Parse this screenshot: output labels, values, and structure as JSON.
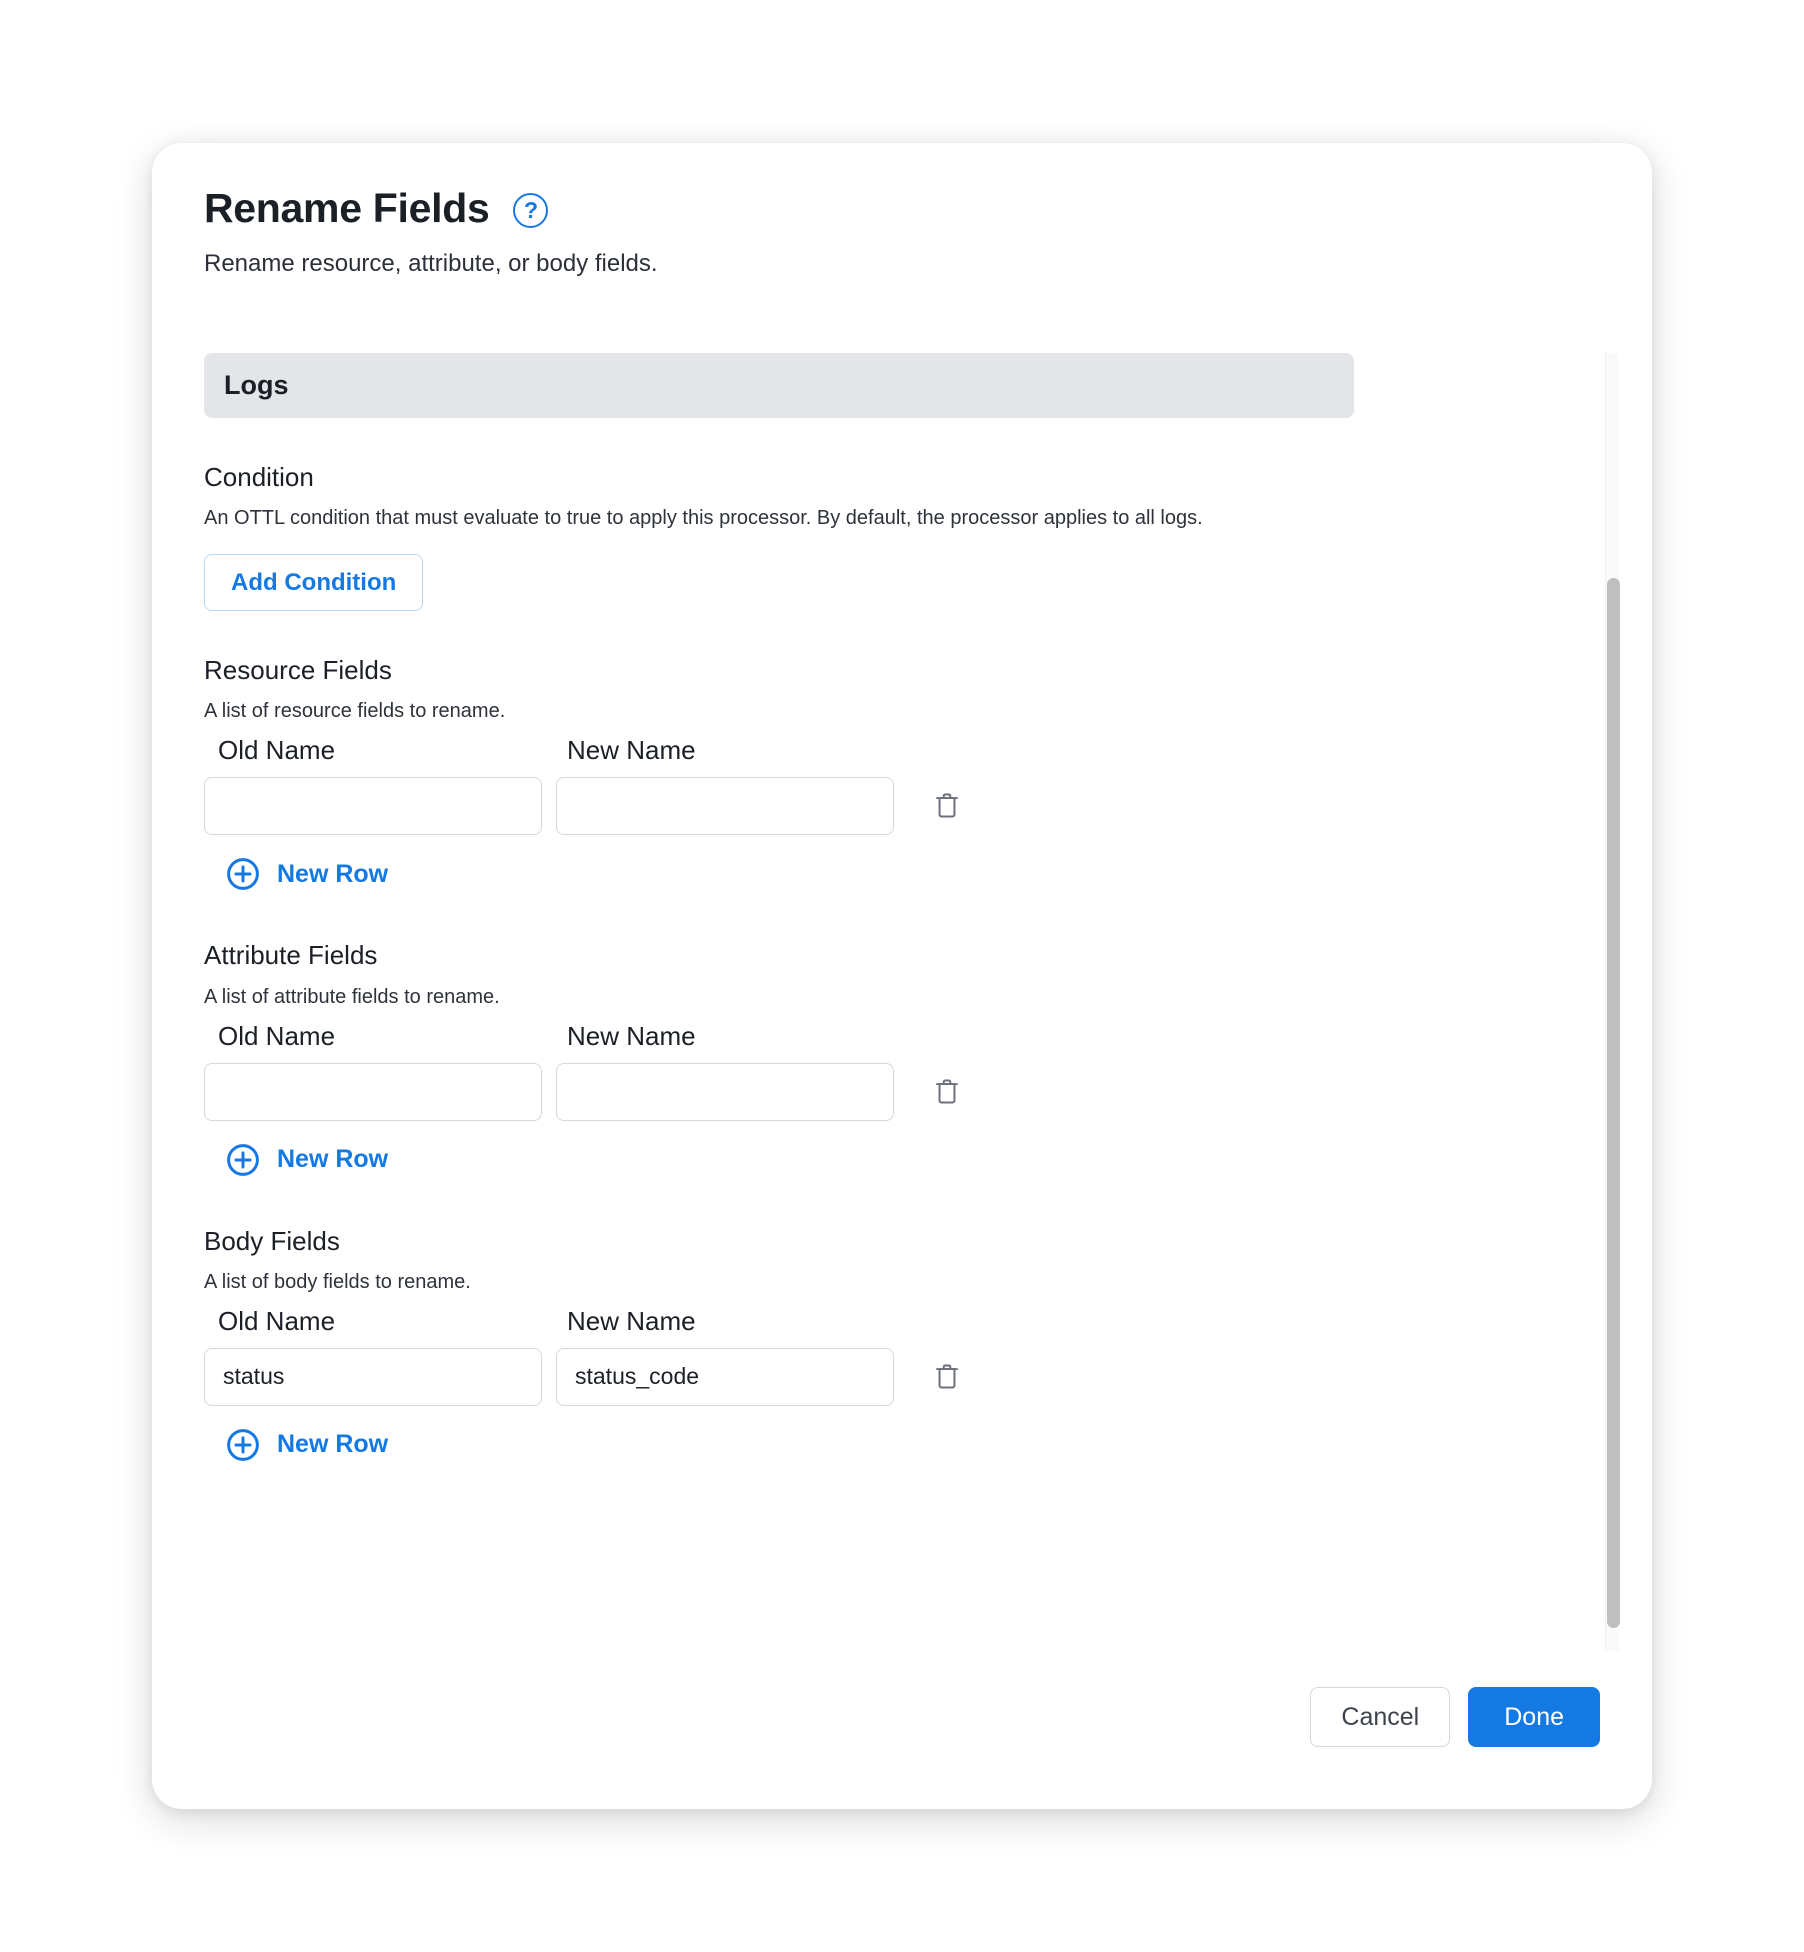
{
  "dialog": {
    "title": "Rename Fields",
    "subtitle": "Rename resource, attribute, or body fields.",
    "help_icon": "question-mark-circle-icon",
    "section_label": "Logs",
    "accent_color": "#1579e3",
    "section_bar_color": "#e3e5e9"
  },
  "condition": {
    "title": "Condition",
    "description": "An OTTL condition that must evaluate to true to apply this processor. By default, the processor applies to all logs.",
    "add_button": "Add Condition"
  },
  "columns": {
    "old_name": "Old Name",
    "new_name": "New Name"
  },
  "new_row_label": "New Row",
  "input_placeholder": "",
  "groups": [
    {
      "title": "Resource Fields",
      "description": "A list of resource fields to rename.",
      "rows": [
        {
          "old_name": "",
          "new_name": ""
        }
      ]
    },
    {
      "title": "Attribute Fields",
      "description": "A list of attribute fields to rename.",
      "rows": [
        {
          "old_name": "",
          "new_name": ""
        }
      ]
    },
    {
      "title": "Body Fields",
      "description": "A list of body fields to rename.",
      "rows": [
        {
          "old_name": "status",
          "new_name": "status_code"
        }
      ]
    }
  ],
  "footer": {
    "cancel_label": "Cancel",
    "done_label": "Done"
  }
}
